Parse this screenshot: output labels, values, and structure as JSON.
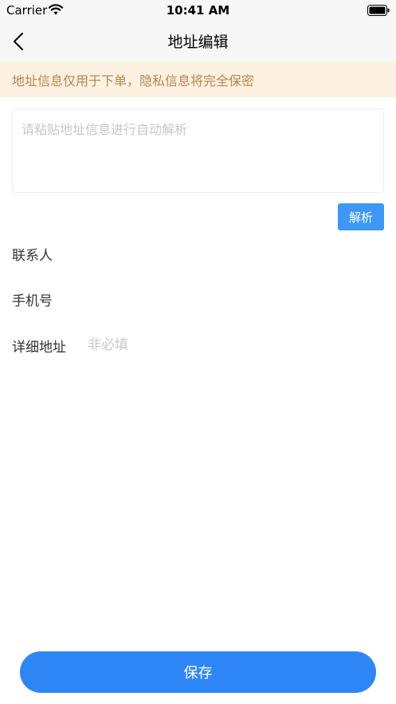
{
  "status_bar": {
    "carrier": "Carrier",
    "time": "10:41 AM"
  },
  "nav": {
    "title": "地址编辑"
  },
  "notice": {
    "text": "地址信息仅用于下单，隐私信息将完全保密"
  },
  "paste": {
    "placeholder": "请粘贴地址信息进行自动解析",
    "value": ""
  },
  "parse_button": {
    "label": "解析"
  },
  "form": {
    "contact": {
      "label": "联系人",
      "placeholder": "",
      "value": ""
    },
    "phone": {
      "label": "手机号",
      "placeholder": "",
      "value": ""
    },
    "address": {
      "label": "详细地址",
      "placeholder": "非必填",
      "value": ""
    }
  },
  "save_button": {
    "label": "保存"
  },
  "colors": {
    "accent": "#2e86f6",
    "parse_button": "#3d98f5",
    "notice_bg": "#fdf1e2",
    "notice_text": "#b5884a"
  }
}
